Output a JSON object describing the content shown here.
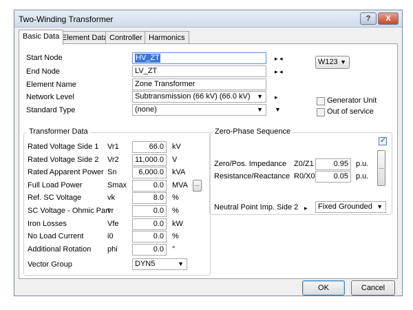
{
  "window": {
    "title": "Two-Winding Transformer",
    "help_label": "?",
    "close_label": "X"
  },
  "tabs": [
    "Basic Data",
    "Element Data",
    "Controller",
    "Harmonics"
  ],
  "basic": {
    "start_node_label": "Start Node",
    "start_node": "HV_ZT",
    "end_node_label": "End Node",
    "end_node": "LV_ZT",
    "element_name_label": "Element Name",
    "element_name": "Zone Transformer",
    "network_level_label": "Network Level",
    "network_level": "Subtransmission (66 kV) (66.0 kV)",
    "standard_type_label": "Standard Type",
    "standard_type": "(none)",
    "variant": "W123",
    "generator_unit_label": "Generator Unit",
    "generator_unit_checked": false,
    "out_of_service_label": "Out of service",
    "out_of_service_checked": false
  },
  "transformer_data": {
    "title": "Transformer Data",
    "rows": [
      {
        "label": "Rated Voltage Side 1",
        "symbol": "Vr1",
        "value": "66.0",
        "unit": "kV"
      },
      {
        "label": "Rated Voltage Side 2",
        "symbol": "Vr2",
        "value": "11,000.0",
        "unit": "V"
      },
      {
        "label": "Rated Apparent Power",
        "symbol": "Sn",
        "value": "6,000.0",
        "unit": "kVA"
      },
      {
        "label": "Full Load Power",
        "symbol": "Smax",
        "value": "0.0",
        "unit": "MVA"
      },
      {
        "label": "Ref. SC Voltage",
        "symbol": "vk",
        "value": "8.0",
        "unit": "%"
      },
      {
        "label": "SC Voltage - Ohmic Part",
        "symbol": "vr",
        "value": "0.0",
        "unit": "%"
      },
      {
        "label": "Iron Losses",
        "symbol": "Vfe",
        "value": "0.0",
        "unit": "kW"
      },
      {
        "label": "No Load Current",
        "symbol": "i0",
        "value": "0.0",
        "unit": "%"
      },
      {
        "label": "Additional Rotation",
        "symbol": "phi",
        "value": "0.0",
        "unit": "°"
      }
    ],
    "vector_group_label": "Vector Group",
    "vector_group": "DYN5"
  },
  "zero_phase": {
    "title": "Zero-Phase Sequence",
    "checkbox_checked": true,
    "rows": [
      {
        "label": "Zero/Pos. Impedance",
        "symbol": "Z0/Z1",
        "value": "0.95",
        "unit": "p.u."
      },
      {
        "label": "Resistance/Reactance",
        "symbol": "R0/X0",
        "value": "0.05",
        "unit": "p.u."
      }
    ],
    "neutral_label": "Neutral Point Imp. Side 2",
    "neutral_value": "Fixed Grounded"
  },
  "buttons": {
    "ok": "OK",
    "cancel": "Cancel",
    "more": "..."
  }
}
